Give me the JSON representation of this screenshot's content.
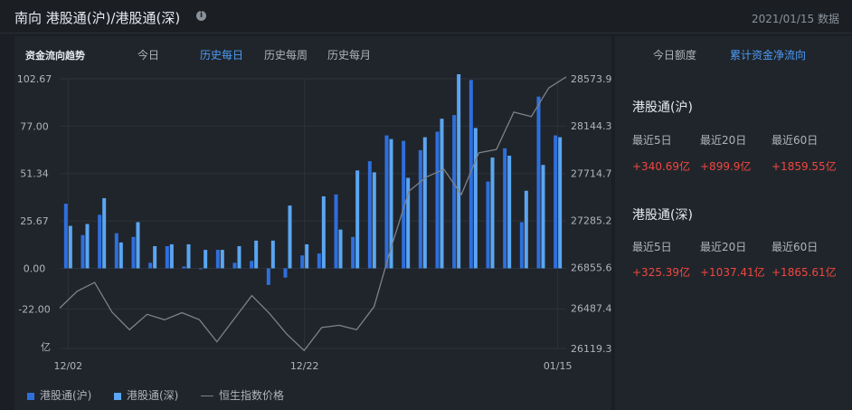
{
  "header": {
    "title": "南向 港股通(沪)/港股通(深)",
    "date_note": "2021/01/15 数据"
  },
  "chart_panel": {
    "tabs_label": "资金流向趋势",
    "tabs": [
      "今日",
      "历史每日",
      "历史每周",
      "历史每月"
    ],
    "active_tab": "历史每日"
  },
  "right_panel": {
    "tabs": [
      "今日额度",
      "累计资金净流向"
    ],
    "active_tab": "累计资金净流向",
    "sections": [
      {
        "title": "港股通(沪)",
        "labels": [
          "最近5日",
          "最近20日",
          "最近60日"
        ],
        "values": [
          "+340.69亿",
          "+899.9亿",
          "+1859.55亿"
        ]
      },
      {
        "title": "港股通(深)",
        "labels": [
          "最近5日",
          "最近20日",
          "最近60日"
        ],
        "values": [
          "+325.39亿",
          "+1037.41亿",
          "+1865.61亿"
        ]
      }
    ]
  },
  "colors": {
    "sh": "#2f6fdd",
    "sz": "#5aa6f2",
    "index_line": "#7d8289",
    "positive": "#f0473f",
    "accent": "#4c9bf5"
  },
  "chart_data": {
    "type": "bar",
    "title": "",
    "ylabel_left": "亿",
    "left_axis_ticks": [
      102.67,
      77.0,
      51.34,
      25.67,
      0.0,
      -22.0
    ],
    "right_axis_ticks": [
      28573.9,
      28144.3,
      27714.7,
      27285.2,
      26855.6,
      26487.4,
      26119.3
    ],
    "ylim_left": [
      -43.4,
      102.67
    ],
    "ylim_right": [
      26119.3,
      28573.9
    ],
    "x_tick_labels": [
      "12/02",
      "12/22",
      "01/15"
    ],
    "x_tick_index": [
      0,
      14,
      29
    ],
    "series": [
      {
        "name": "港股通(沪)",
        "axis": "left",
        "values": [
          35,
          18,
          29,
          19,
          17,
          3,
          12,
          1,
          0,
          10,
          3,
          4,
          -9,
          -5,
          7,
          8,
          40,
          17,
          58,
          72,
          69,
          64,
          74,
          83,
          102,
          47,
          65,
          25,
          93,
          72
        ]
      },
      {
        "name": "港股通(深)",
        "axis": "left",
        "values": [
          23,
          24,
          38,
          14,
          25,
          12,
          13,
          13,
          10,
          10,
          12,
          15,
          15,
          34,
          13,
          39,
          21,
          53,
          52,
          70,
          49,
          71,
          81,
          112,
          76,
          60,
          61,
          42,
          56,
          71
        ]
      },
      {
        "name": "恒生指数价格",
        "axis": "right",
        "type": "line",
        "values": [
          26487,
          26640,
          26720,
          26450,
          26290,
          26430,
          26380,
          26445,
          26380,
          26180,
          26390,
          26600,
          26440,
          26250,
          26100,
          26310,
          26330,
          26290,
          26500,
          27050,
          27550,
          27680,
          27750,
          27520,
          27900,
          27930,
          28270,
          28230,
          28490,
          28590
        ]
      }
    ],
    "grid": true,
    "legend_position": "bottom-left"
  }
}
